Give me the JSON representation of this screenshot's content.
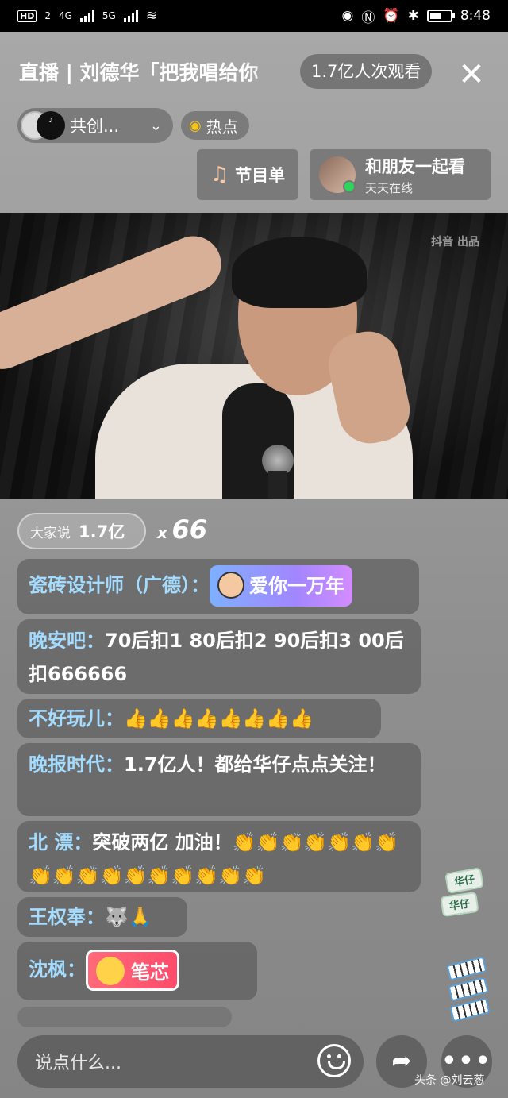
{
  "status_bar": {
    "hd_badge": "HD",
    "sim_badge": "2",
    "net1": "4G",
    "net2": "5G",
    "time": "8:48"
  },
  "header": {
    "title": "直播 | 刘德华「把我唱给你",
    "viewer_count": "1.7亿人次观看",
    "close_label": "✕",
    "cocreate_label": "共创...",
    "hot_label": "热点",
    "program_label": "节目单",
    "watch_together_title": "和朋友一起看",
    "watch_together_sub": "天天在线"
  },
  "video": {
    "watermark": "抖音 出品"
  },
  "chat": {
    "everyone_label": "大家说",
    "everyone_count": "1.7亿",
    "combo_x": "x",
    "combo_n": "66",
    "messages": [
      {
        "user": "瓷砖设计师（广德）：",
        "text": "",
        "sticker": "爱你一万年"
      },
      {
        "user": "晚安吧：",
        "text": "70后扣1  80后扣2  90后扣3  00后扣666666"
      },
      {
        "user": "不好玩儿：",
        "text": "👍👍👍👍👍👍👍👍"
      },
      {
        "user": "晚报时代：",
        "text": "1.7亿人！都给华仔点点关注！"
      },
      {
        "user": "北 漂：",
        "text": "突破两亿 加油！👏👏👏👏👏👏👏👏👏👏👏👏👏👏👏👏👏"
      },
      {
        "user": "王权奉：",
        "text": "🐺🙏"
      },
      {
        "user": "沈枫：",
        "text": "",
        "sticker": "笔芯"
      }
    ]
  },
  "side_widget": {
    "card1": "华仔",
    "card2": "华仔"
  },
  "bottom": {
    "input_placeholder": "说点什么...",
    "share_icon": "➦",
    "more_icon": "•••",
    "credit": "头条 @刘云葱"
  }
}
